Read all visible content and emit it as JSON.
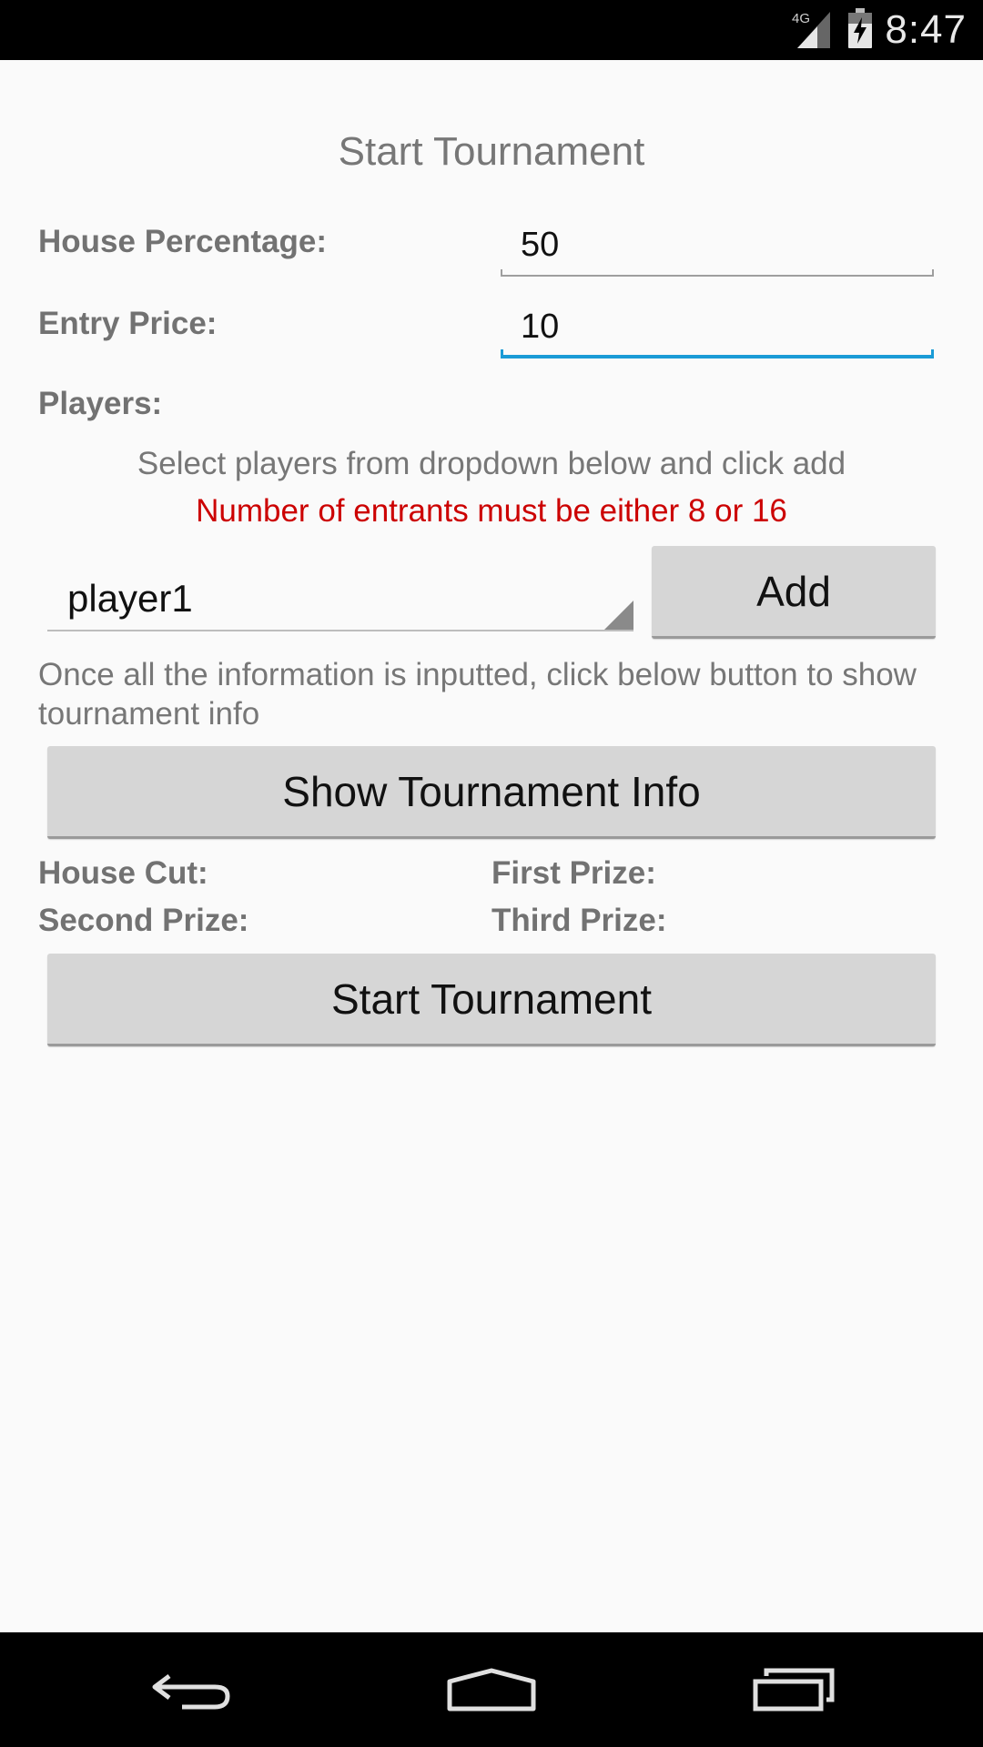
{
  "status_bar": {
    "network_label": "4G",
    "time": "8:47"
  },
  "page": {
    "title": "Start Tournament"
  },
  "form": {
    "house_percentage_label": "House Percentage:",
    "house_percentage_value": "50",
    "entry_price_label": "Entry Price:",
    "entry_price_value": "10",
    "players_label": "Players:"
  },
  "players": {
    "instruction": "Select players from dropdown below and click add",
    "warning": "Number of entrants must be either 8 or 16",
    "selected_player": "player1",
    "add_label": "Add"
  },
  "info": {
    "instruction": "Once all the information is inputted, click below button to show tournament info",
    "show_info_label": "Show Tournament Info"
  },
  "results": {
    "house_cut_label": "House Cut:",
    "first_prize_label": "First Prize:",
    "second_prize_label": "Second Prize:",
    "third_prize_label": "Third Prize:"
  },
  "actions": {
    "start_label": "Start Tournament"
  },
  "colors": {
    "accent": "#1a9bd6",
    "warning": "#cc0000",
    "button_bg": "#d6d6d6",
    "background": "#fafafa"
  }
}
